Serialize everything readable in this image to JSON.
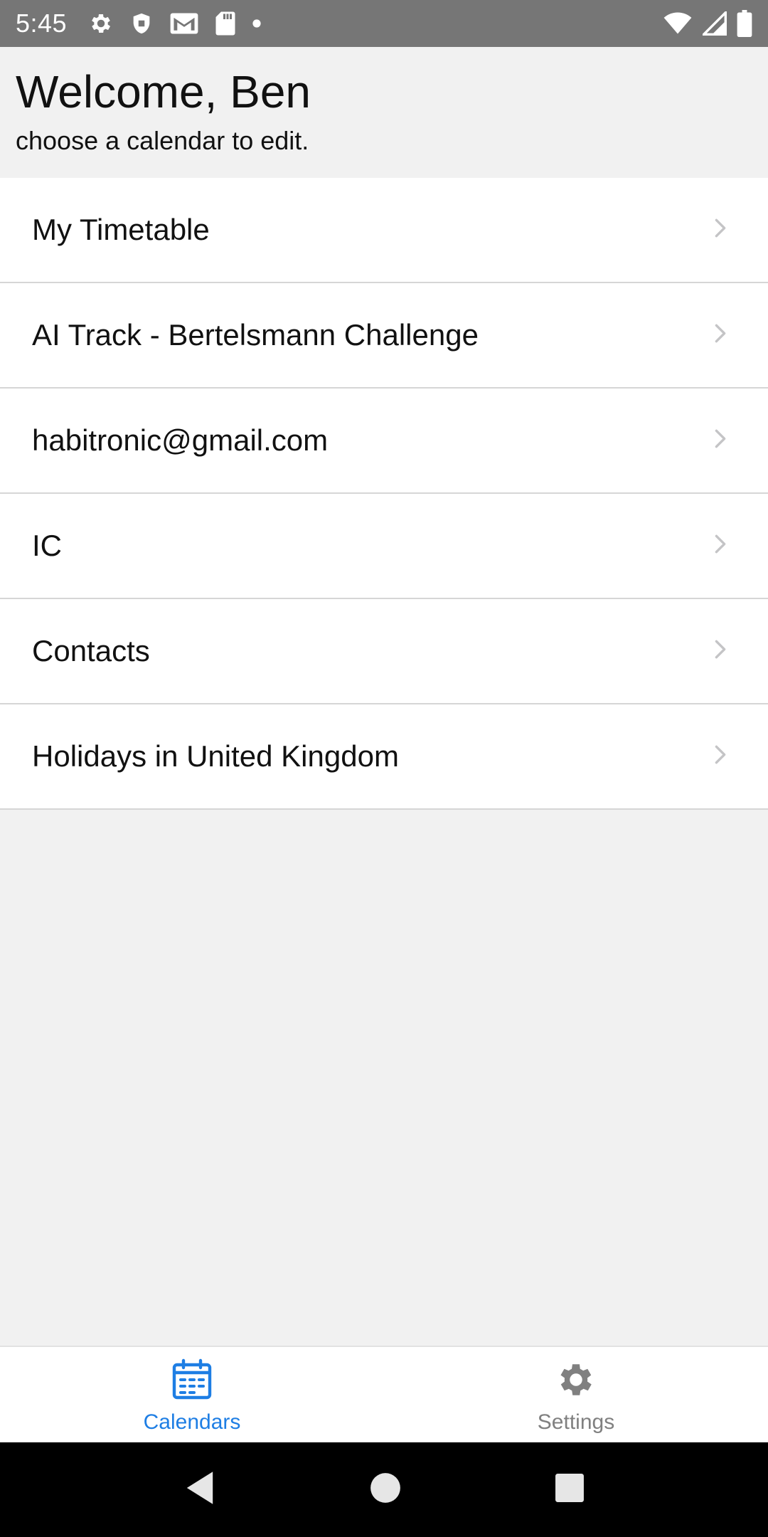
{
  "status_bar": {
    "time": "5:45",
    "left_icons": [
      "gear-icon",
      "shield-icon",
      "gmail-icon",
      "sd-card-icon",
      "dot-icon"
    ],
    "right_icons": [
      "wifi-icon",
      "cell-signal-icon",
      "battery-icon"
    ]
  },
  "header": {
    "title": "Welcome, Ben",
    "subtitle": "choose a calendar to edit."
  },
  "calendars": [
    {
      "label": "My Timetable"
    },
    {
      "label": "AI Track - Bertelsmann Challenge"
    },
    {
      "label": "habitronic@gmail.com"
    },
    {
      "label": "IC"
    },
    {
      "label": "Contacts"
    },
    {
      "label": "Holidays in United Kingdom"
    }
  ],
  "tab_bar": {
    "tabs": [
      {
        "label": "Calendars",
        "icon": "calendar-icon",
        "active": true
      },
      {
        "label": "Settings",
        "icon": "gear-icon",
        "active": false
      }
    ]
  },
  "colors": {
    "accent": "#1e7ee4",
    "status_bar": "#767676",
    "background": "#f1f1f1",
    "inactive_tab": "#808080"
  },
  "nav_bar": {
    "buttons": [
      "back-icon",
      "home-icon",
      "recents-icon"
    ]
  }
}
